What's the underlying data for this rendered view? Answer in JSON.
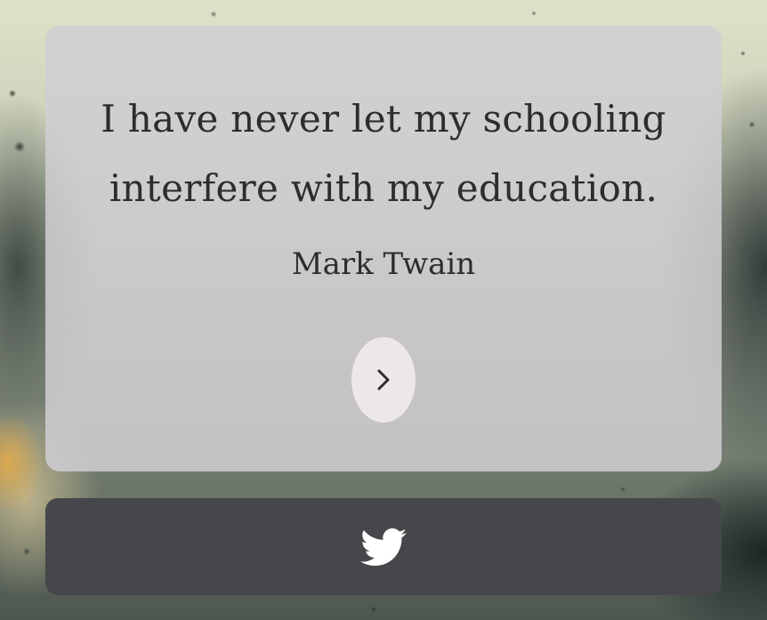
{
  "quote": {
    "text": "I have never let my schooling interfere with my education.",
    "author": "Mark Twain"
  },
  "controls": {
    "next_icon": "chevron-right-icon"
  },
  "share": {
    "icon": "twitter-icon"
  },
  "colors": {
    "card_background": "#d0cdd2",
    "text": "#2f2c2c",
    "button_background": "#ece7ea",
    "share_bar_background": "#46474a",
    "share_icon": "#ffffff"
  }
}
